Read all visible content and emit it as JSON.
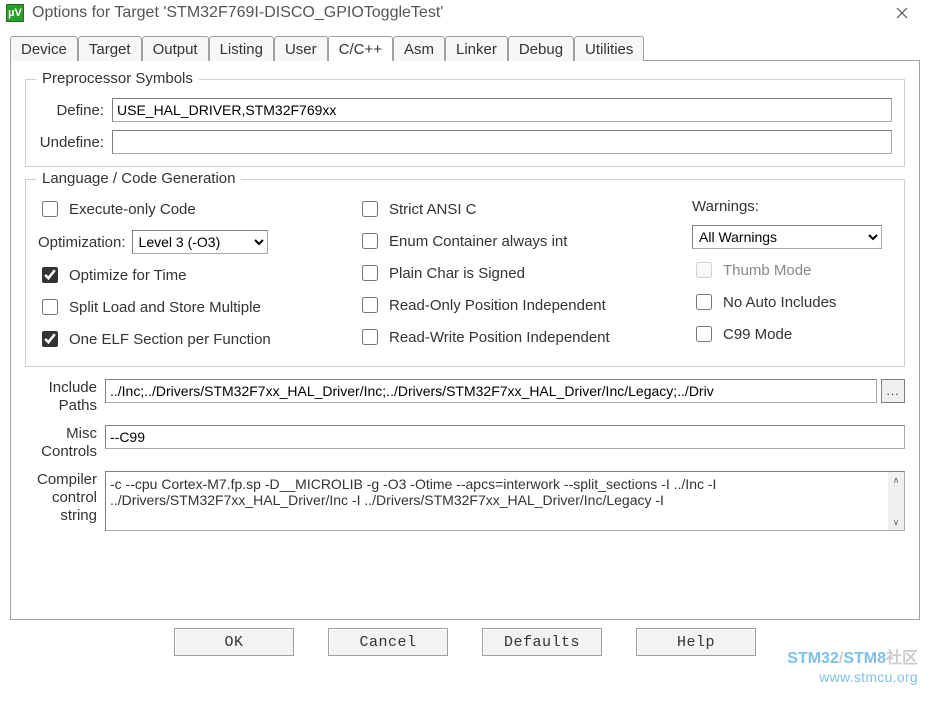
{
  "window": {
    "title": "Options for Target 'STM32F769I-DISCO_GPIOToggleTest'"
  },
  "tabs": [
    "Device",
    "Target",
    "Output",
    "Listing",
    "User",
    "C/C++",
    "Asm",
    "Linker",
    "Debug",
    "Utilities"
  ],
  "active_tab": "C/C++",
  "preproc": {
    "legend": "Preprocessor Symbols",
    "define_lbl": "Define:",
    "define_val": "USE_HAL_DRIVER,STM32F769xx",
    "undef_lbl": "Undefine:",
    "undef_val": ""
  },
  "lang": {
    "legend": "Language / Code Generation",
    "exec_only": "Execute-only Code",
    "opt_lbl": "Optimization:",
    "opt_val": "Level 3 (-O3)",
    "opt_time": "Optimize for Time",
    "split_ls": "Split Load and Store Multiple",
    "one_elf": "One ELF Section per Function",
    "strict_ansi": "Strict ANSI C",
    "enum_int": "Enum Container always int",
    "plain_char": "Plain Char is Signed",
    "ro_pi": "Read-Only Position Independent",
    "rw_pi": "Read-Write Position Independent",
    "warn_lbl": "Warnings:",
    "warn_val": "All Warnings",
    "thumb": "Thumb Mode",
    "no_auto": "No Auto Includes",
    "c99": "C99 Mode"
  },
  "paths": {
    "include_lbl": "Include Paths",
    "include_val": "../Inc;../Drivers/STM32F7xx_HAL_Driver/Inc;../Drivers/STM32F7xx_HAL_Driver/Inc/Legacy;../Driv",
    "misc_lbl": "Misc Controls",
    "misc_val": "--C99",
    "compiler_lbl": "Compiler control string",
    "compiler_val": "-c --cpu Cortex-M7.fp.sp -D__MICROLIB -g -O3 -Otime --apcs=interwork --split_sections -I ../Inc -I ../Drivers/STM32F7xx_HAL_Driver/Inc -I ../Drivers/STM32F7xx_HAL_Driver/Inc/Legacy -I"
  },
  "buttons": {
    "ok": "OK",
    "cancel": "Cancel",
    "defaults": "Defaults",
    "help": "Help"
  },
  "watermark": {
    "line1a": "STM32",
    "line1slash": "/",
    "line1b": "STM8",
    "line1c": "社区",
    "url": "www.stmcu.org"
  }
}
